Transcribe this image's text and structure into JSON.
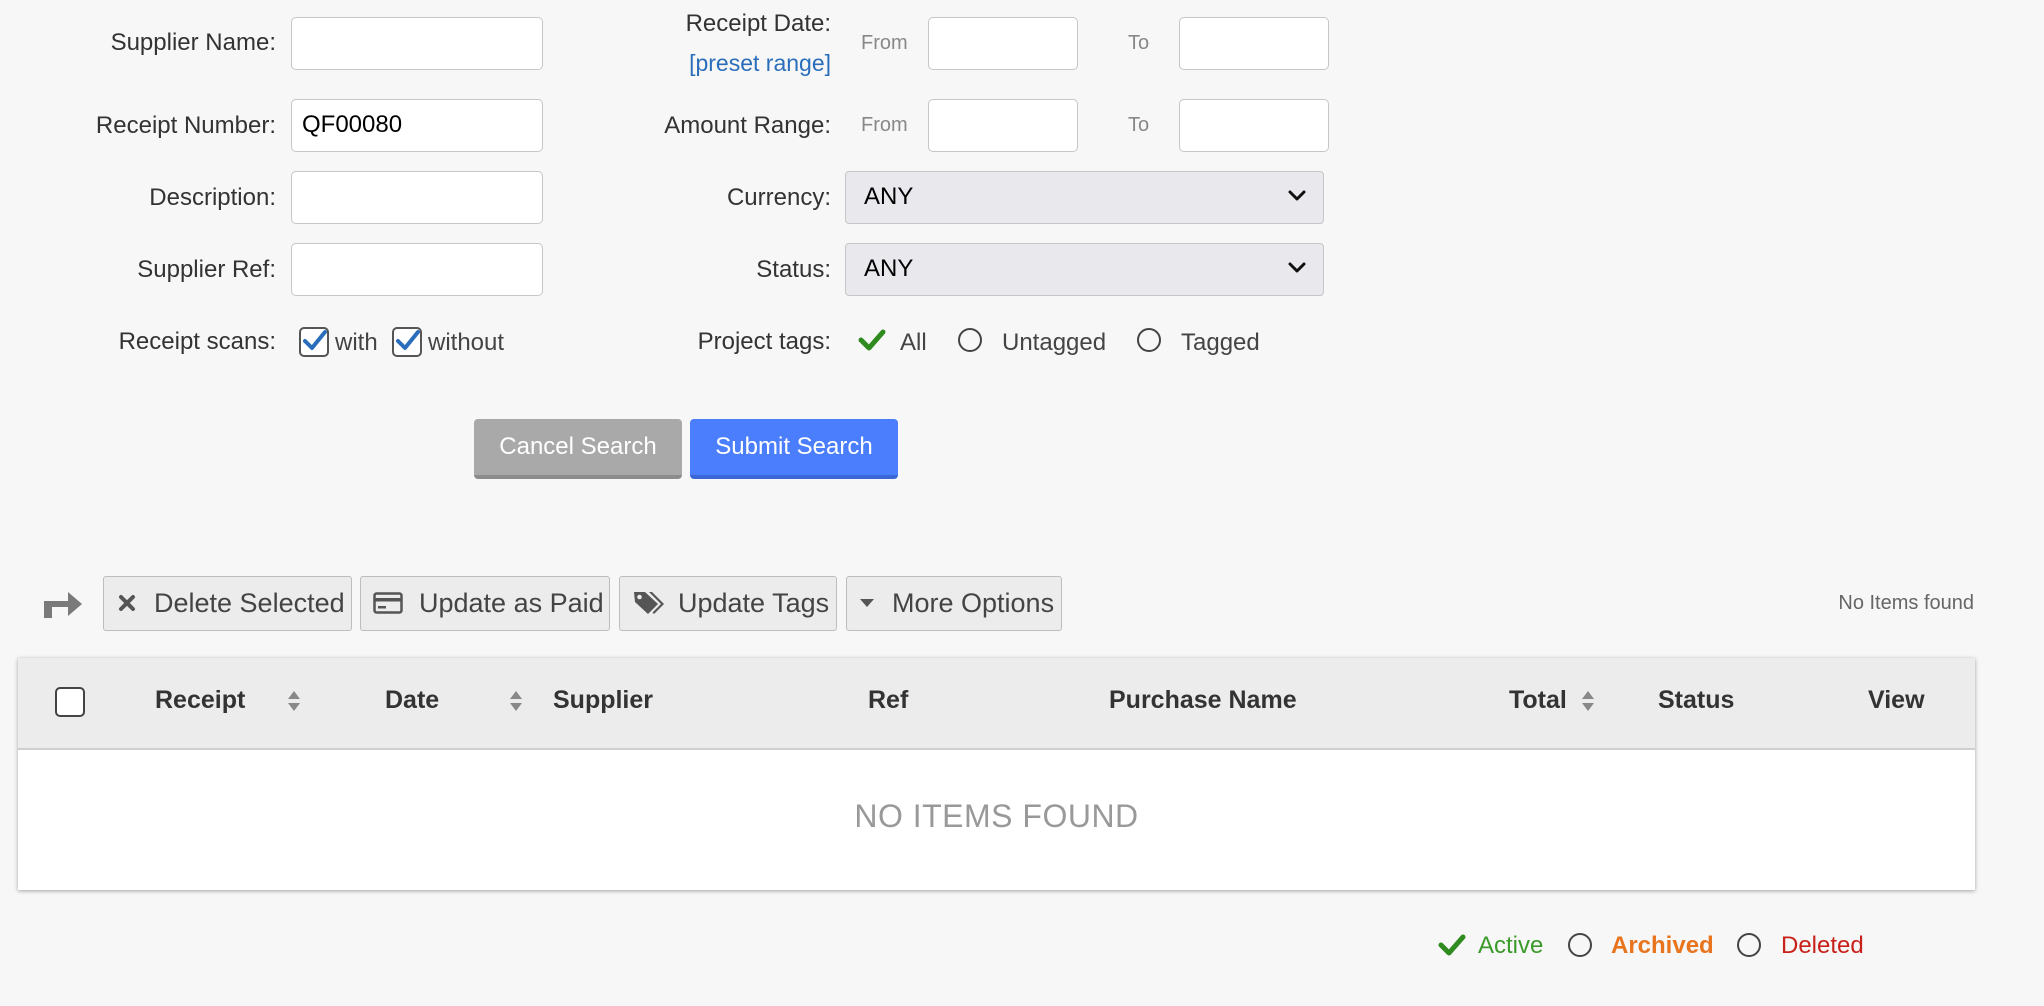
{
  "search_form": {
    "supplier_name": {
      "label": "Supplier Name:",
      "value": ""
    },
    "receipt_number": {
      "label": "Receipt Number:",
      "value": "QF00080"
    },
    "description": {
      "label": "Description:",
      "value": ""
    },
    "supplier_ref": {
      "label": "Supplier Ref:",
      "value": ""
    },
    "receipt_scans": {
      "label": "Receipt scans:",
      "options": [
        {
          "label": "with",
          "checked": true
        },
        {
          "label": "without",
          "checked": true
        }
      ]
    },
    "receipt_date": {
      "label": "Receipt Date:",
      "preset_link": "[preset range]",
      "from_hint": "From",
      "to_hint": "To",
      "from_value": "",
      "to_value": ""
    },
    "amount_range": {
      "label": "Amount Range:",
      "from_hint": "From",
      "to_hint": "To",
      "from_value": "",
      "to_value": ""
    },
    "currency": {
      "label": "Currency:",
      "selected": "ANY"
    },
    "status": {
      "label": "Status:",
      "selected": "ANY"
    },
    "project_tags": {
      "label": "Project tags:",
      "options": [
        {
          "label": "All",
          "selected": true
        },
        {
          "label": "Untagged",
          "selected": false
        },
        {
          "label": "Tagged",
          "selected": false
        }
      ]
    },
    "cancel_label": "Cancel Search",
    "submit_label": "Submit Search"
  },
  "toolbar": {
    "delete_selected": "Delete Selected",
    "update_as_paid": "Update as Paid",
    "update_tags": "Update Tags",
    "more_options": "More Options",
    "items_status": "No Items found"
  },
  "table": {
    "columns": {
      "receipt": "Receipt",
      "date": "Date",
      "supplier": "Supplier",
      "ref": "Ref",
      "purchase_name": "Purchase Name",
      "total": "Total",
      "status": "Status",
      "view": "View"
    },
    "empty_message": "NO ITEMS FOUND"
  },
  "legend": {
    "active": "Active",
    "archived": "Archived",
    "deleted": "Deleted",
    "colors": {
      "active": "#3a9a2a",
      "archived": "#e8741e",
      "deleted": "#c8201a"
    }
  }
}
